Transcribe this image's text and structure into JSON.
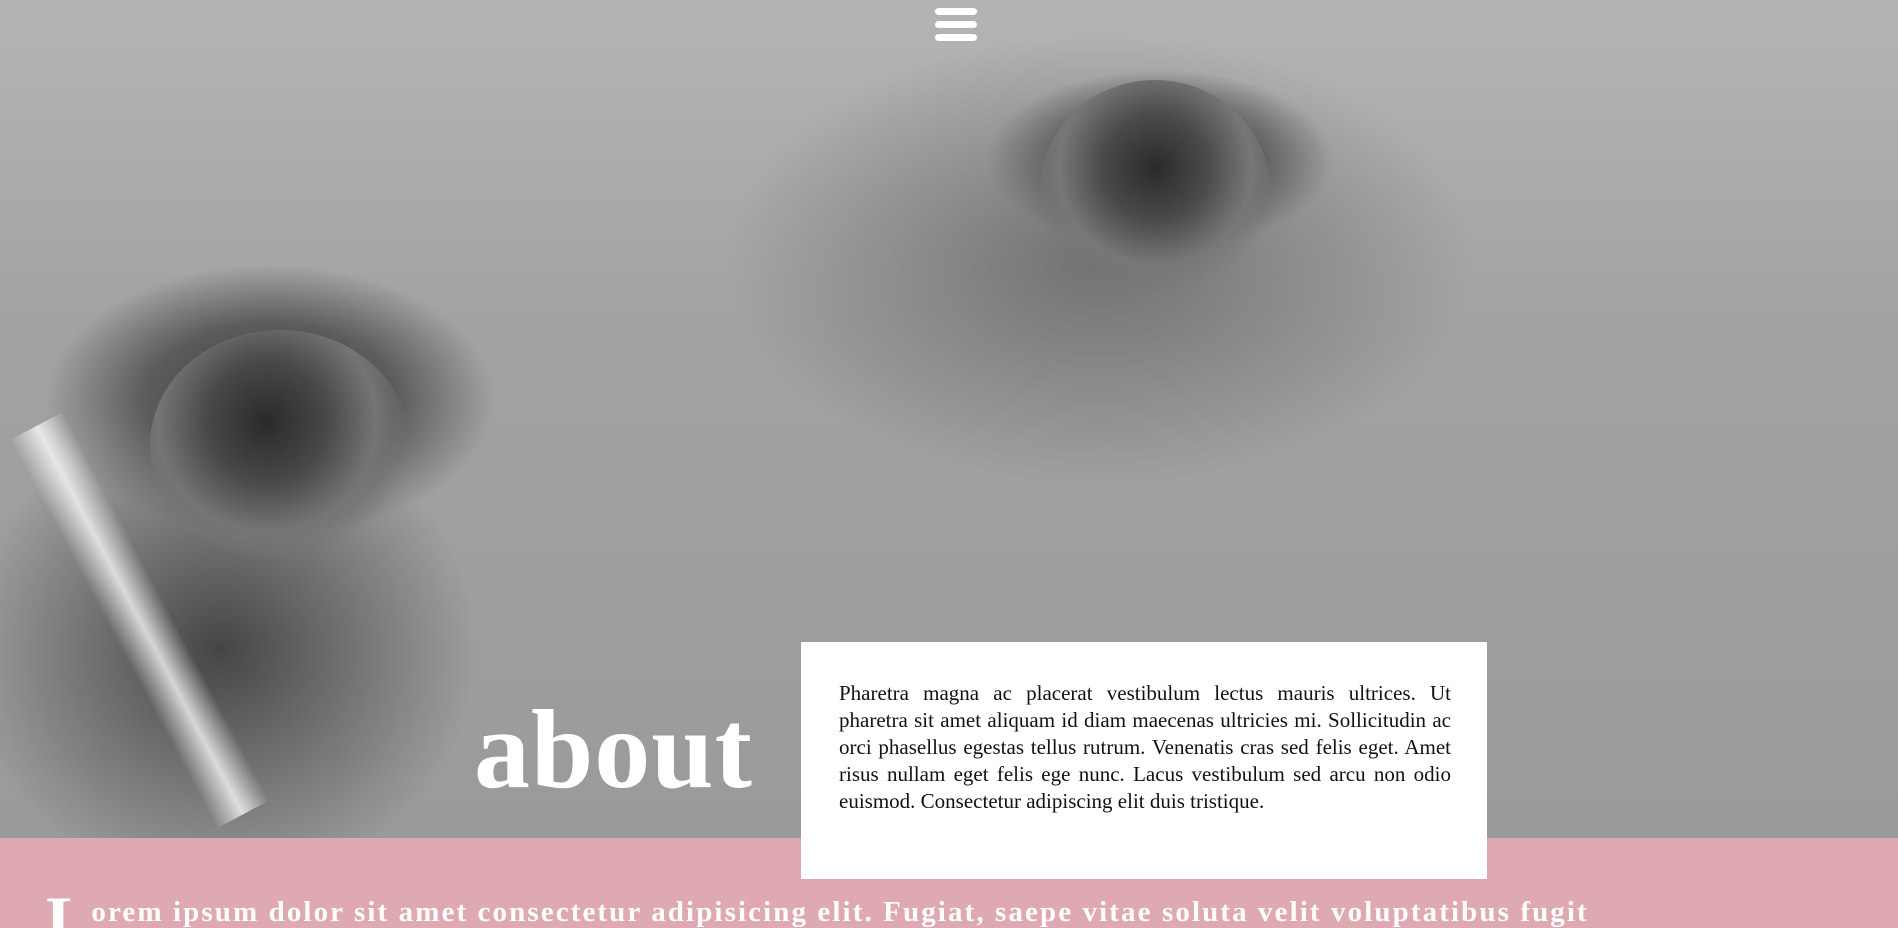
{
  "nav": {
    "menu_icon": "hamburger-menu-icon"
  },
  "hero": {
    "image": "black-and-white close-up photo of eyes"
  },
  "about": {
    "title": "about",
    "paragraph": "Pharetra magna ac placerat vestibulum lectus mauris ultrices. Ut pharetra sit amet aliquam id diam maecenas ultricies mi. Sollicitudin ac orci phasellus egestas tellus rutrum. Venenatis cras sed felis eget. Amet risus nullam eget felis ege nunc. Lacus vestibulum sed arcu non odio euismod. Consectetur adipiscing elit duis tristique."
  },
  "intro": {
    "drop_cap": "L",
    "text": "orem ipsum dolor sit amet consectetur adipisicing elit. Fugiat, saepe vitae soluta velit voluptatibus fugit"
  },
  "colors": {
    "band_pink": "#dea9b1",
    "card_white": "#ffffff",
    "title_white": "#ffffff"
  }
}
